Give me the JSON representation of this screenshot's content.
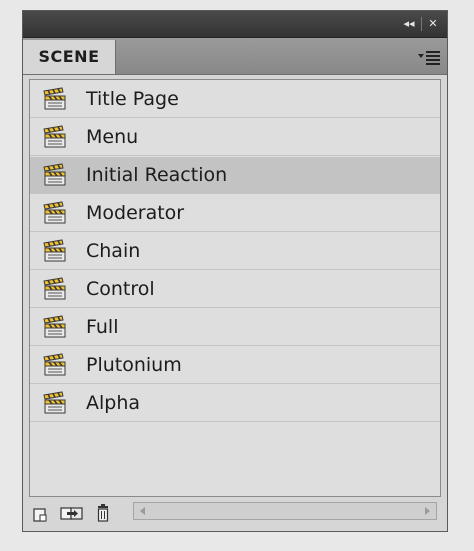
{
  "panel": {
    "tab_label": "SCENE",
    "collapse_glyph": "◂◂",
    "close_glyph": "✕"
  },
  "scenes": [
    {
      "label": "Title Page",
      "icon": "clapperboard-icon"
    },
    {
      "label": "Menu",
      "icon": "clapperboard-icon"
    },
    {
      "label": "Initial Reaction",
      "icon": "clapperboard-icon",
      "selected": true
    },
    {
      "label": "Moderator",
      "icon": "clapperboard-icon"
    },
    {
      "label": "Chain",
      "icon": "clapperboard-icon"
    },
    {
      "label": "Control",
      "icon": "clapperboard-icon"
    },
    {
      "label": "Full",
      "icon": "clapperboard-icon"
    },
    {
      "label": "Plutonium",
      "icon": "clapperboard-icon"
    },
    {
      "label": "Alpha",
      "icon": "clapperboard-icon"
    }
  ],
  "bottom_toolbar": {
    "buttons": [
      "add-scene-icon",
      "duplicate-scene-icon",
      "delete-scene-icon"
    ]
  },
  "colors": {
    "selected_row": "#c3c3c3",
    "titlebar": "#3c3c3c"
  }
}
